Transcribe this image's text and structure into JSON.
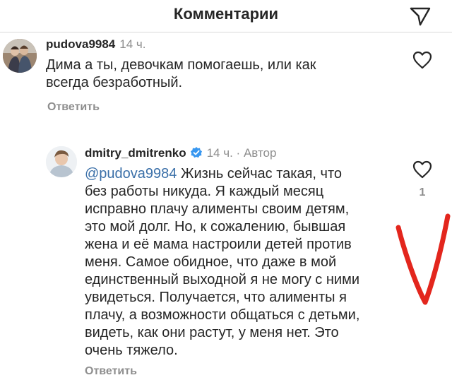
{
  "header": {
    "title": "Комментарии",
    "share_icon": "paper-plane-icon"
  },
  "comments": [
    {
      "username": "pudova9984",
      "time": "14 ч.",
      "text_lines": [
        "Дима а ты, девочкам помогаешь, или как",
        "всегда безработный."
      ],
      "reply_label": "Ответить",
      "like_icon": "heart-outline-icon"
    },
    {
      "username": "dmitry_dmitrenko",
      "verified_icon": "verified-badge-icon",
      "time": "14 ч.",
      "separator": "·",
      "author_label": "Автор",
      "mention": "@pudova9984",
      "text_first": " Жизнь сейчас такая, что",
      "text_lines": [
        "без работы никуда. Я каждый месяц",
        "исправно плачу алименты своим детям,",
        "это мой долг. Но, к сожалению, бывшая",
        "жена и её мама настроили детей против",
        "меня. Самое обидное, что даже в мой",
        "единственный выходной я не могу с ними",
        "увидеться. Получается, что алименты я",
        "плачу, а возможности общаться с детьми,",
        "видеть, как они растут, у меня нет. Это",
        "очень тяжело."
      ],
      "reply_label": "Ответить",
      "like_icon": "heart-outline-icon",
      "like_count": "1"
    }
  ],
  "annotation": {
    "type": "red-checkmark",
    "color": "#e3261d"
  },
  "colors": {
    "text": "#262626",
    "secondary": "#8e8e8e",
    "mention": "#3a6fa8",
    "verified": "#3897f0"
  }
}
